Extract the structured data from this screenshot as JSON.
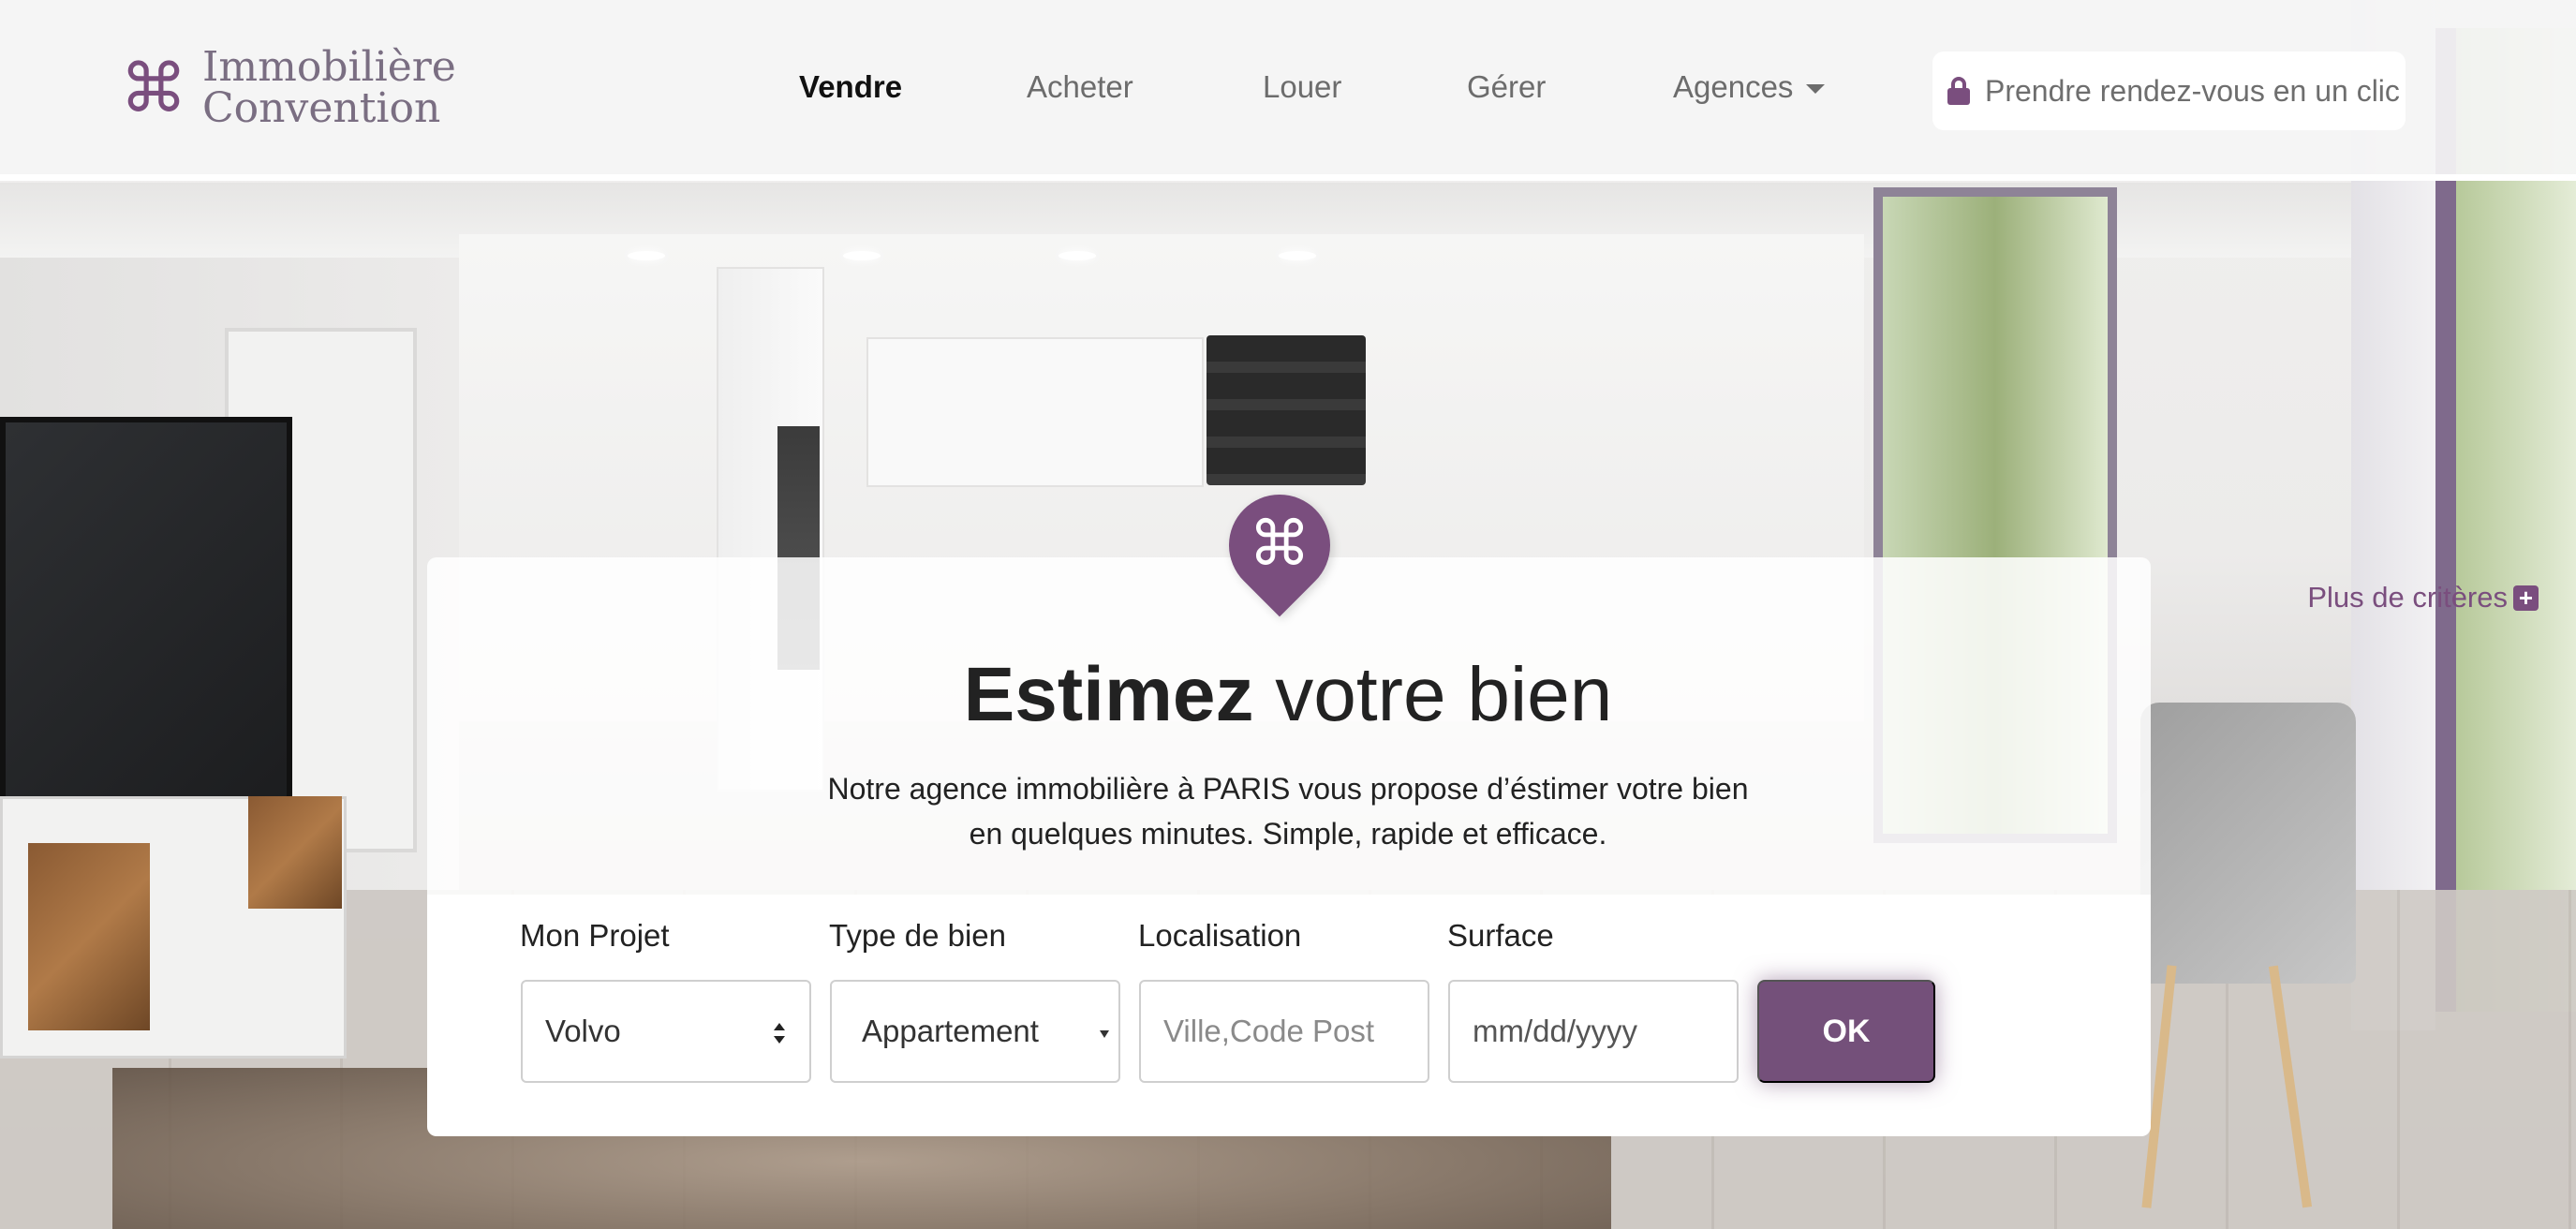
{
  "brand": {
    "line1": "Immobilière",
    "line2": "Convention",
    "logo_icon": "command-icon",
    "color": "#7a4e7e"
  },
  "nav": {
    "items": [
      {
        "label": "Vendre",
        "active": true
      },
      {
        "label": "Acheter",
        "active": false
      },
      {
        "label": "Louer",
        "active": false
      },
      {
        "label": "Gérer",
        "active": false
      },
      {
        "label": "Agences",
        "active": false,
        "dropdown": true
      }
    ],
    "cta": {
      "label": "Prendre rendez-vous en un clic",
      "icon": "lock-icon"
    }
  },
  "card": {
    "more_criteria": "Plus de critères",
    "title_bold": "Estimez",
    "title_rest": "votre bien",
    "description_line1": "Notre agence immobilière à PARIS vous propose d’éstimer votre bien",
    "description_line2": "en quelques minutes. Simple, rapide et efficace."
  },
  "form": {
    "project": {
      "label": "Mon Projet",
      "value": "Volvo"
    },
    "property_type": {
      "label": "Type de bien",
      "value": "Appartement"
    },
    "location": {
      "label": "Localisation",
      "placeholder": "Ville,Code Post"
    },
    "surface": {
      "label": "Surface",
      "placeholder": "mm/dd/yyyy"
    },
    "submit": "OK"
  },
  "colors": {
    "accent": "#7a4e7e",
    "button": "#74507a"
  }
}
